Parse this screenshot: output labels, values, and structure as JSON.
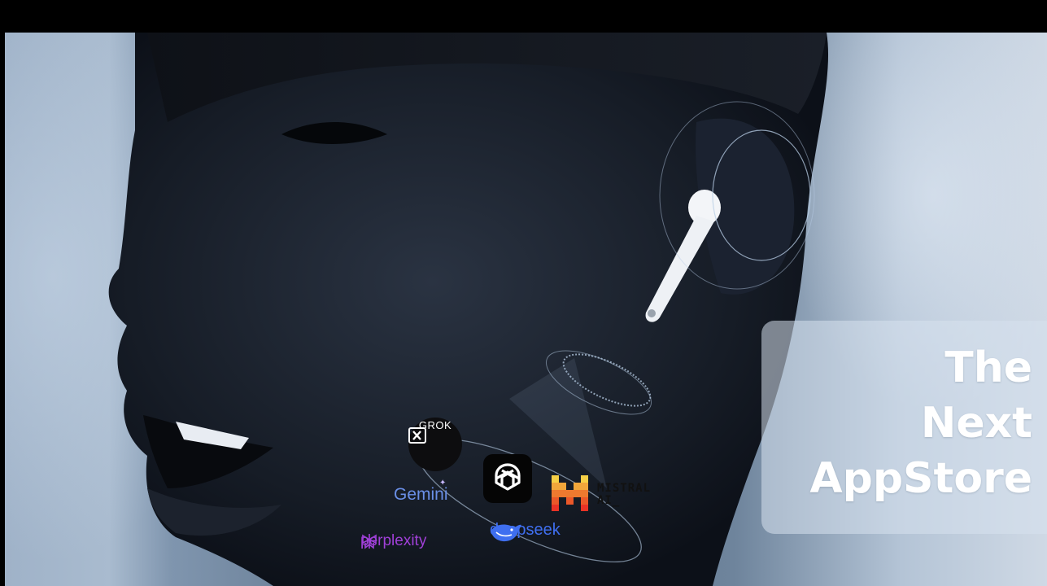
{
  "headline": {
    "line1": "The",
    "line2": "Next",
    "line3": "AppStore"
  },
  "logos": {
    "grok": {
      "name": "GROK",
      "icon": "xai-grok-icon"
    },
    "gemini": {
      "name": "Gemini",
      "color": "#6a8fe6"
    },
    "openai": {
      "icon": "openai-knot-icon"
    },
    "mistral": {
      "name_line1": "MISTRAL",
      "name_line2": "AI_",
      "colors": [
        "#f7d046",
        "#f2a73b",
        "#ee792f",
        "#eb5829",
        "#ea3326"
      ]
    },
    "perplexity": {
      "name": "perplexity",
      "color": "#a040d8"
    },
    "deepseek": {
      "name": "deepseek",
      "color": "#3f6ff0"
    }
  }
}
